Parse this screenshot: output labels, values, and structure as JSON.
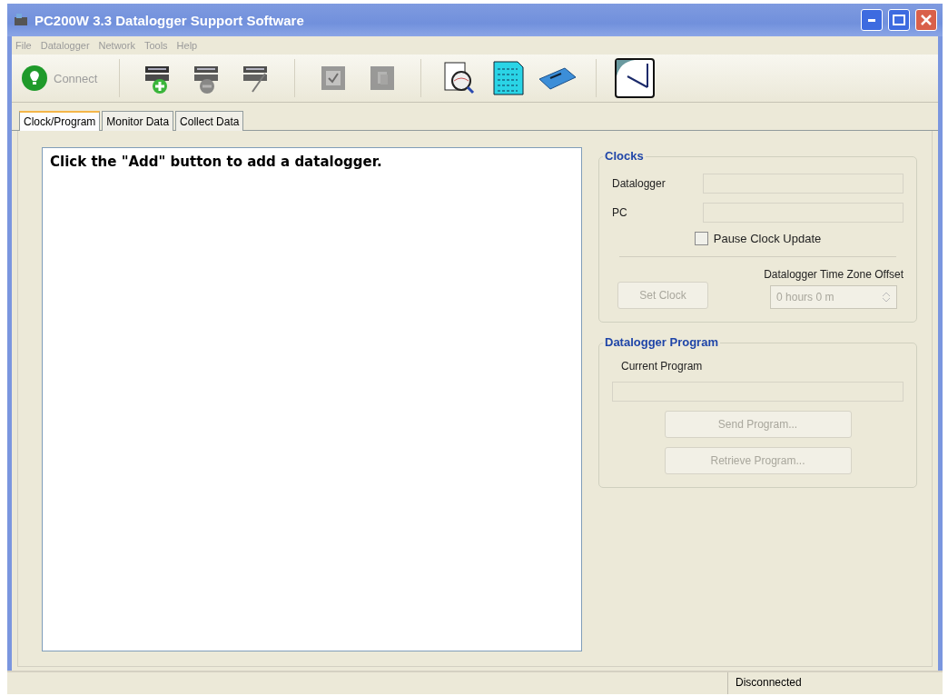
{
  "window": {
    "title": "PC200W 3.3 Datalogger Support Software"
  },
  "menu": [
    "File",
    "Datalogger",
    "Network",
    "Tools",
    "Help"
  ],
  "toolbar": {
    "connect": {
      "label": "Connect",
      "disabled": true
    },
    "tools": [
      {
        "kind": "add",
        "disabled": false
      },
      {
        "kind": "remove",
        "disabled": true
      },
      {
        "kind": "edit",
        "disabled": true
      },
      {
        "kind": "sep"
      },
      {
        "kind": "check",
        "disabled": true
      },
      {
        "kind": "copy",
        "disabled": true
      },
      {
        "kind": "sep"
      },
      {
        "kind": "view",
        "disabled": false
      },
      {
        "kind": "data",
        "disabled": false
      },
      {
        "kind": "card",
        "disabled": false
      },
      {
        "kind": "sep"
      },
      {
        "kind": "clock",
        "disabled": false
      }
    ]
  },
  "tabs": [
    {
      "label": "Clock/Program",
      "selected": true
    },
    {
      "label": "Monitor Data",
      "selected": false
    },
    {
      "label": "Collect Data",
      "selected": false
    }
  ],
  "message": "Click the \"Add\" button to add a datalogger.",
  "clocks": {
    "title": "Clocks",
    "fields": [
      {
        "label": "Datalogger"
      },
      {
        "label": "PC"
      }
    ],
    "pause": {
      "label": "Pause Clock Update",
      "checked": false
    },
    "set_clock": {
      "label": "Set Clock",
      "disabled": true
    },
    "offset_label": "Datalogger Time Zone Offset",
    "offset_value": "0 hours 0 m"
  },
  "program": {
    "title": "Datalogger Program",
    "current_label": "Current Program",
    "buttons": [
      {
        "label": "Send Program...",
        "disabled": true
      },
      {
        "label": "Retrieve Program...",
        "disabled": true
      }
    ]
  },
  "status_bar": {
    "status": "Disconnected"
  }
}
